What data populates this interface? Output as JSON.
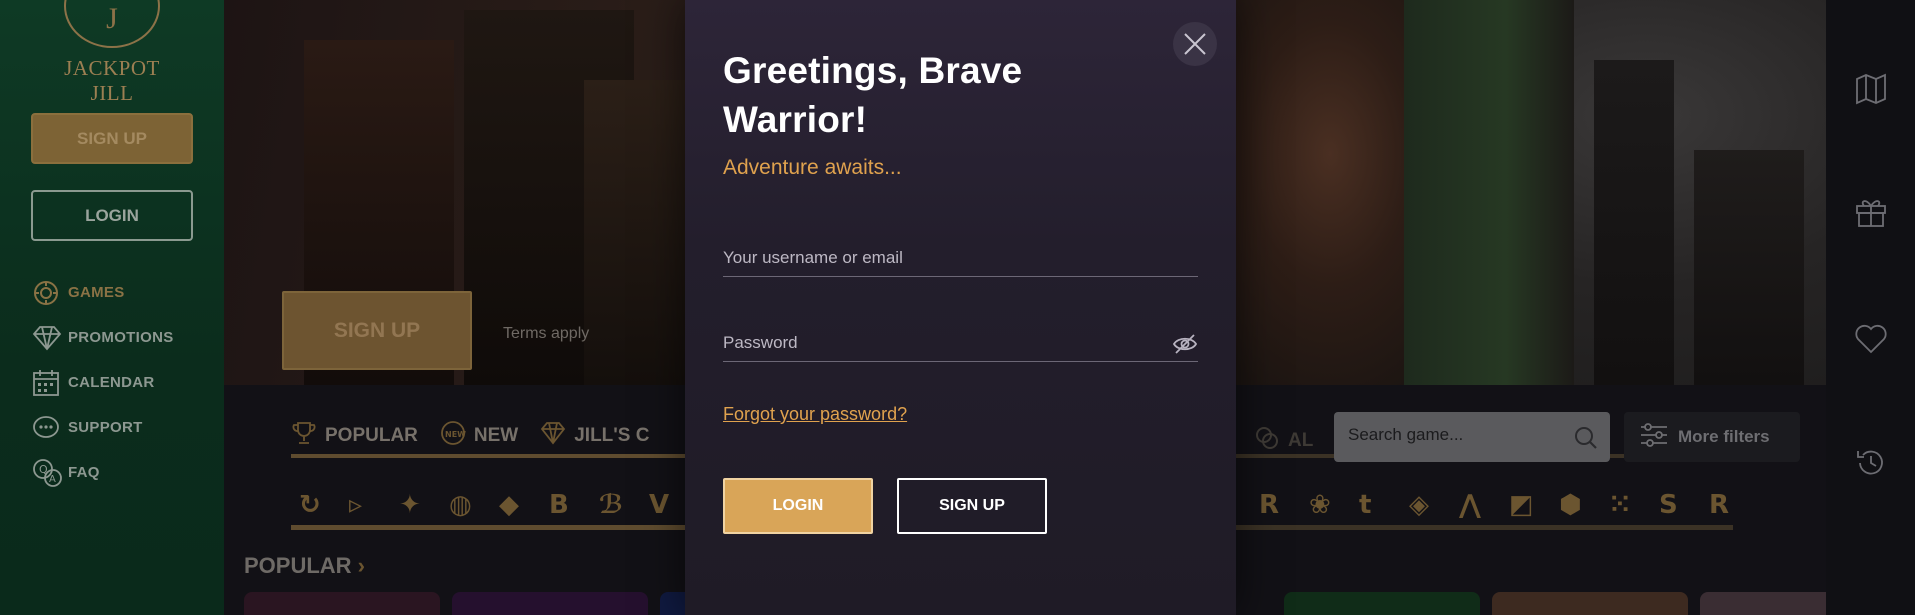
{
  "sidebar": {
    "logo_text": "JACKPOT JILL",
    "logo_letter": "J",
    "signup_label": "SIGN UP",
    "login_label": "LOGIN",
    "items": [
      {
        "label": "GAMES",
        "icon": "chip-icon"
      },
      {
        "label": "PROMOTIONS",
        "icon": "diamond-icon"
      },
      {
        "label": "CALENDAR",
        "icon": "calendar-icon"
      },
      {
        "label": "SUPPORT",
        "icon": "chat-icon"
      },
      {
        "label": "FAQ",
        "icon": "faq-icon"
      }
    ]
  },
  "banner": {
    "signup_label": "SIGN UP",
    "terms": "Terms apply"
  },
  "lobby": {
    "tabs": [
      {
        "label": "POPULAR",
        "icon": "trophy-icon"
      },
      {
        "label": "NEW",
        "icon": "new-badge-icon"
      },
      {
        "label": "JILL'S C",
        "icon": "diamond-icon"
      }
    ],
    "all_label": "AL",
    "search_placeholder": "Search game...",
    "more_filters": "More filters",
    "popular_title": "POPULAR",
    "chevron": "›"
  },
  "modal": {
    "title": "Greetings, Brave Warrior!",
    "subtitle": "Adventure awaits...",
    "username_placeholder": "Your username or email",
    "password_placeholder": "Password",
    "forgot": "Forgot your password?",
    "login_label": "LOGIN",
    "signup_label": "SIGN UP"
  },
  "rail": {
    "icons": [
      "map-icon",
      "gift-icon",
      "heart-icon",
      "history-icon"
    ]
  },
  "colors": {
    "accent_gold": "#d9a558",
    "modal_bg": "#2d2538",
    "sidebar_green": "#0e3a25"
  }
}
